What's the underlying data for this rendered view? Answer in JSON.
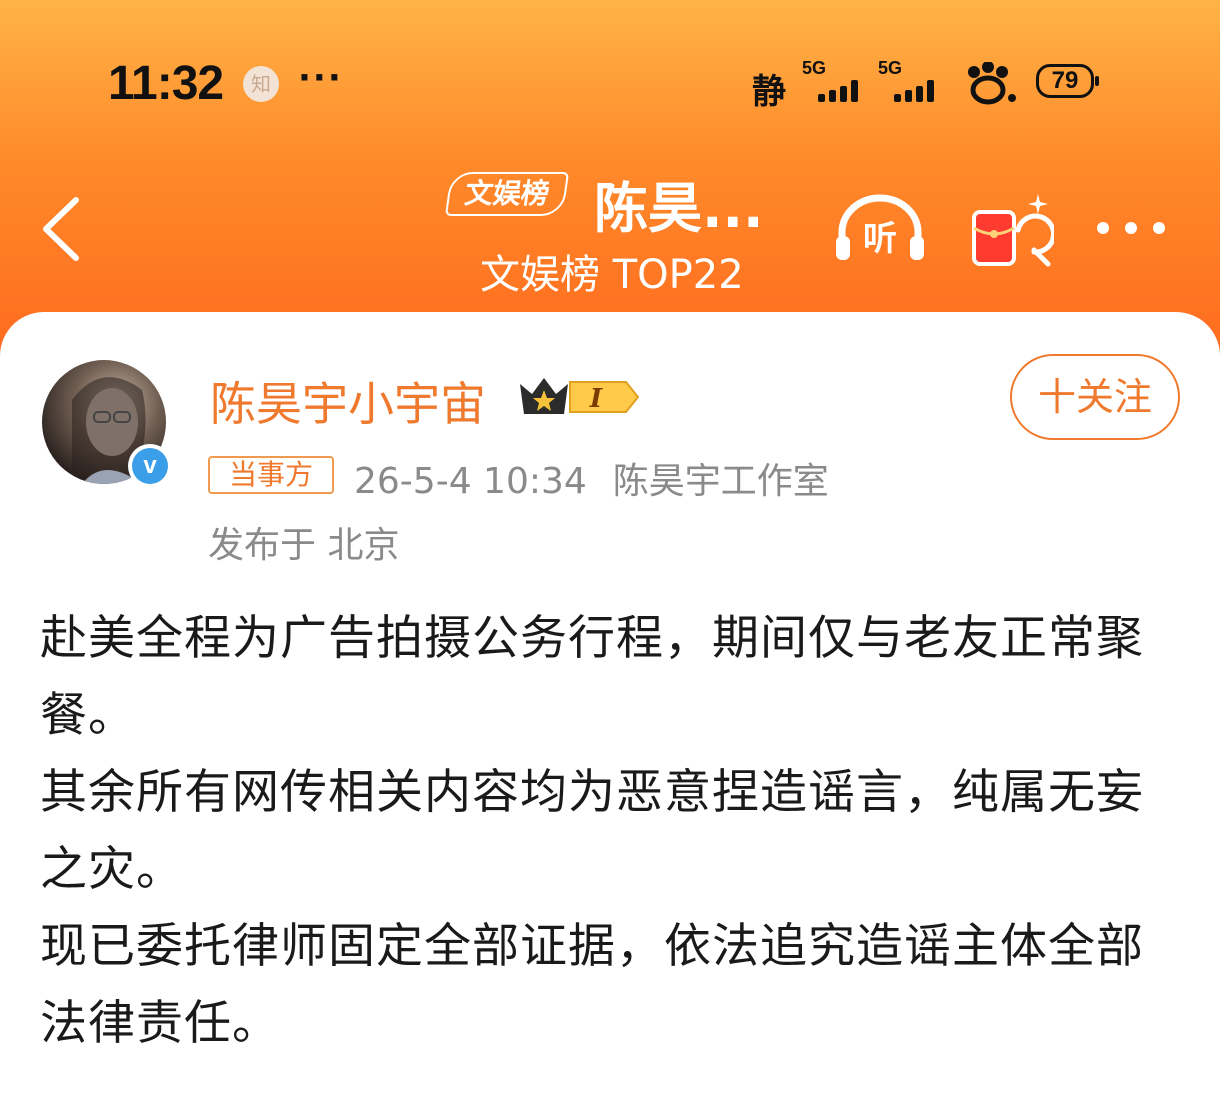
{
  "status_bar": {
    "time": "11:32",
    "notif_icon_label": "知",
    "more_dots": "···",
    "mode_label": "静",
    "signal1_label": "5G",
    "signal2_label": "5G",
    "battery_level": "79"
  },
  "nav": {
    "rank_badge": "文娱榜",
    "title": "陈昊...",
    "subtitle": "文娱榜 TOP22",
    "listen_label": "听"
  },
  "post": {
    "username": "陈昊宇小宇宙",
    "level_badge": "I",
    "follow_label": "十关注",
    "party_badge": "当事方",
    "timestamp": "26-5-4 10:34",
    "source": "陈昊宇工作室",
    "location": "发布于 北京",
    "body": "赴美全程为广告拍摄公务行程，期间仅与老友正常聚餐。\n其余所有网传相关内容均为恶意捏造谣言，纯属无妄之灾。\n现已委托律师固定全部证据，依法追究造谣主体全部法律责任。"
  },
  "colors": {
    "header_top": "#ffb347",
    "header_bottom": "#ff6a1e",
    "accent": "#ef7a2e",
    "meta_text": "#8a8a8a",
    "verify_blue": "#3a9ee8"
  }
}
